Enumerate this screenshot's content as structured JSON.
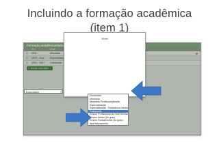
{
  "slide": {
    "title_line1": "Incluindo a formação acadêmica",
    "title_line2": "(item 1)"
  },
  "app": {
    "header": "Formação acadêmica/titulação",
    "columns": [
      "",
      "Ano",
      "Nível",
      "Instituição"
    ],
    "rows": [
      {
        "num": "1",
        "year": "2011 -",
        "level": "Mestrado",
        "inst": "Universidade Federal do Rio Grande"
      },
      {
        "num": "2",
        "year": "2010 - 2011",
        "level": "Especialização",
        "inst": "Anhanguera Educacional, Vitória do Rio Grande"
      },
      {
        "num": "3",
        "year": "2004 - 2007",
        "level": "Graduação",
        "inst": "Universidade Federal do Rio Grande"
      }
    ],
    "add_button": "Incluir novo item"
  },
  "modal": {
    "label": "Nível",
    "select_value": "Doutorado",
    "options": [
      "Doutorado",
      "Mestrado",
      "Mestrado Profissionalizante",
      "Especialização",
      "Especialização - Residência médica",
      "Graduação",
      "Ensino Profissional de nível técnico",
      "Ensino Médio (2o grau)",
      "Ensino Fundamental (1o grau)",
      "Aperfeiçoamento"
    ],
    "highlighted_option": "Graduação"
  },
  "colors": {
    "arrow": "#3d78c9",
    "header_green": "#6f8a6a",
    "add_green": "#3c8a3a",
    "selection_blue": "#3a76d6"
  }
}
